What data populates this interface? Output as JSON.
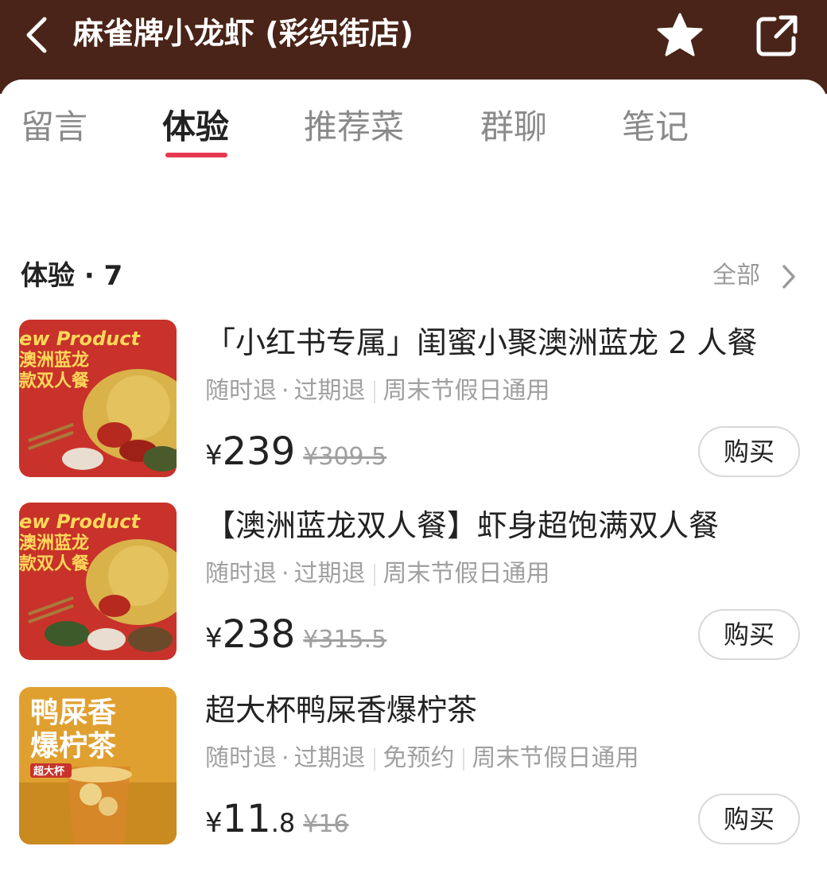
{
  "header": {
    "title": "麻雀牌小龙虾 (彩织街店)",
    "bg_color": "#4a2418"
  },
  "tabs": [
    {
      "label": "留言",
      "active": false
    },
    {
      "label": "体验",
      "active": true
    },
    {
      "label": "推荐菜",
      "active": false
    },
    {
      "label": "群聊",
      "active": false
    },
    {
      "label": "笔记",
      "active": false
    }
  ],
  "section": {
    "title": "体验 · 7",
    "see_all": "全部"
  },
  "items": [
    {
      "title": "「小红书专属」闺蜜小聚澳洲蓝龙 2 人餐",
      "tags": [
        "随时退",
        "过期退"
      ],
      "tags_extra": [
        "周末节假日通用"
      ],
      "currency": "¥",
      "price": "239",
      "price_decimal": "",
      "original_price": "¥309.5",
      "buy": "购买",
      "thumb_text": {
        "line1": "ew Product",
        "line2": "澳洲蓝龙",
        "line3": "款双人餐"
      }
    },
    {
      "title": "【澳洲蓝龙双人餐】虾身超饱满双人餐",
      "tags": [
        "随时退",
        "过期退"
      ],
      "tags_extra": [
        "周末节假日通用"
      ],
      "currency": "¥",
      "price": "238",
      "price_decimal": "",
      "original_price": "¥315.5",
      "buy": "购买",
      "thumb_text": {
        "line1": "ew Product",
        "line2": "澳洲蓝龙",
        "line3": "款双人餐"
      }
    },
    {
      "title": "超大杯鸭屎香爆柠茶",
      "tags": [
        "随时退",
        "过期退"
      ],
      "tags_extra": [
        "免预约",
        "周末节假日通用"
      ],
      "currency": "¥",
      "price": "11",
      "price_decimal": ".8",
      "original_price": "¥16",
      "buy": "购买",
      "thumb_text": {
        "line1": "鸭屎香",
        "line2": "爆柠茶",
        "line3": "超大杯"
      }
    }
  ],
  "colors": {
    "accent": "#e8384f",
    "muted": "#a0a0a0"
  }
}
